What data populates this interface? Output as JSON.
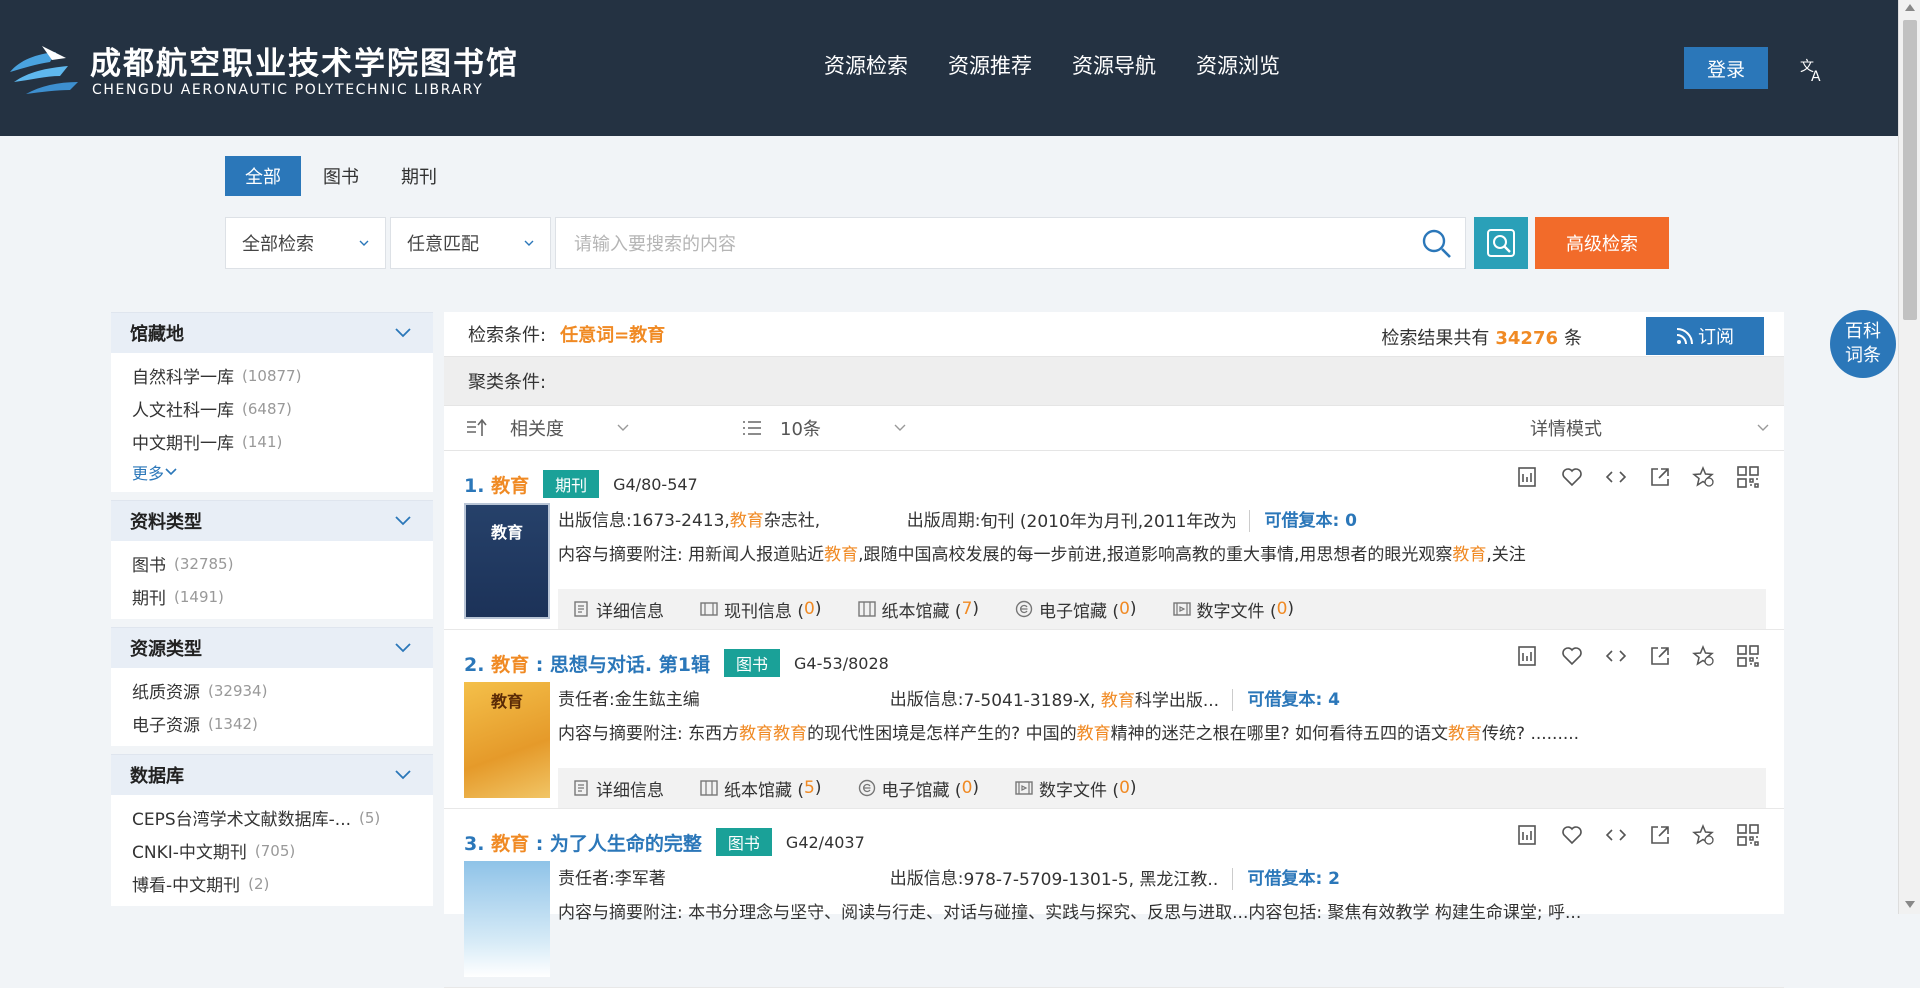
{
  "header": {
    "logo_cn": "成都航空职业技术学院图书馆",
    "logo_en": "CHENGDU AERONAUTIC POLYTECHNIC LIBRARY",
    "nav": [
      "资源检索",
      "资源推荐",
      "资源导航",
      "资源浏览"
    ],
    "login": "登录",
    "lang_icon": "translate-icon"
  },
  "search": {
    "tabs": [
      "全部",
      "图书",
      "期刊"
    ],
    "active_tab": "全部",
    "field_select": "全部检索",
    "match_select": "任意匹配",
    "placeholder": "请输入要搜索的内容",
    "advanced": "高级检索"
  },
  "sidebar": {
    "facets": [
      {
        "title": "馆藏地",
        "items": [
          {
            "label": "自然科学一库",
            "count": "(10877)"
          },
          {
            "label": "人文社科一库",
            "count": "(6487)"
          },
          {
            "label": "中文期刊一库",
            "count": "(141)"
          }
        ],
        "more": "更多"
      },
      {
        "title": "资料类型",
        "items": [
          {
            "label": "图书",
            "count": "(32785)"
          },
          {
            "label": "期刊",
            "count": "(1491)"
          }
        ]
      },
      {
        "title": "资源类型",
        "items": [
          {
            "label": "纸质资源",
            "count": "(32934)"
          },
          {
            "label": "电子资源",
            "count": "(1342)"
          }
        ]
      },
      {
        "title": "数据库",
        "items": [
          {
            "label": "CEPS台湾学术文献数据库-...",
            "count": "(5)"
          },
          {
            "label": "CNKI-中文期刊",
            "count": "(705)"
          },
          {
            "label": "博看-中文期刊",
            "count": "(2)"
          }
        ]
      }
    ]
  },
  "results": {
    "cond_label": "检索条件:",
    "cond_value": "任意词=教育",
    "total_prefix": "检索结果共有",
    "total": "34276",
    "total_suffix": "条",
    "subscribe": "订阅",
    "cluster_label": "聚类条件:",
    "sort": "相关度",
    "page_size": "10条",
    "view_mode": "详情模式",
    "records": [
      {
        "index": "1.",
        "title": "教育",
        "type": "期刊",
        "callno": "G4/80-547",
        "cover_text": "教育",
        "f1_label": "出版信息:",
        "f1_pre": "1673-2413,",
        "f1_hl": "教育",
        "f1_post": "杂志社,",
        "f2_label": "出版周期:",
        "f2_value": "旬刊 (2010年为月刊,2011年改为...",
        "avail_label": "可借复本:",
        "avail": "0",
        "abstract_label": "内容与摘要附注:",
        "abstract": "用新闻人报道贴近教育,跟随中国高校发展的每一步前进,报道影响高教的重大事情,用思想者的眼光观察教育,关注",
        "links": [
          {
            "icon": "detail-icon",
            "label": "详细信息",
            "count": null
          },
          {
            "icon": "periodical-icon",
            "label": "现刊信息",
            "count": "0"
          },
          {
            "icon": "book-holding-icon",
            "label": "纸本馆藏",
            "count": "7"
          },
          {
            "icon": "e-holding-icon",
            "label": "电子馆藏",
            "count": "0"
          },
          {
            "icon": "digital-file-icon",
            "label": "数字文件",
            "count": "0"
          }
        ]
      },
      {
        "index": "2.",
        "title": "教育 : 思想与对话. 第1辑",
        "type": "图书",
        "callno": "G4-53/8028",
        "cover_text": "教育",
        "f1_label": "责任者:",
        "f1_pre": "金生鈜主编",
        "f1_hl": "",
        "f1_post": "",
        "f2_label": "出版信息:",
        "f2_value": "7-5041-3189-X, 教育科学出版...",
        "avail_label": "可借复本:",
        "avail": "4",
        "abstract_label": "内容与摘要附注:",
        "abstract": "东西方教育教育的现代性困境是怎样产生的? 中国的教育精神的迷茫之根在哪里? 如何看待五四的语文教育传统? .........",
        "links": [
          {
            "icon": "detail-icon",
            "label": "详细信息",
            "count": null
          },
          {
            "icon": "book-holding-icon",
            "label": "纸本馆藏",
            "count": "5"
          },
          {
            "icon": "e-holding-icon",
            "label": "电子馆藏",
            "count": "0"
          },
          {
            "icon": "digital-file-icon",
            "label": "数字文件",
            "count": "0"
          }
        ]
      },
      {
        "index": "3.",
        "title": "教育 : 为了人生命的完整",
        "type": "图书",
        "callno": "G42/4037",
        "cover_text": "",
        "f1_label": "责任者:",
        "f1_pre": "李军著",
        "f1_hl": "",
        "f1_post": "",
        "f2_label": "出版信息:",
        "f2_value": "978-7-5709-1301-5, 黑龙江教...",
        "avail_label": "可借复本:",
        "avail": "2",
        "abstract_label": "内容与摘要附注:",
        "abstract": "本书分理念与坚守、阅读与行走、对话与碰撞、实践与探究、反思与进取...内容包括: 聚焦有效教学 构建生命课堂; 呼...",
        "links": []
      }
    ]
  },
  "baike": [
    "百科",
    "词条"
  ],
  "colors": {
    "header_bg": "#243242",
    "primary": "#2b77b9",
    "accent": "#f08a24",
    "badge": "#1aa198",
    "advanced": "#f26b2a"
  }
}
